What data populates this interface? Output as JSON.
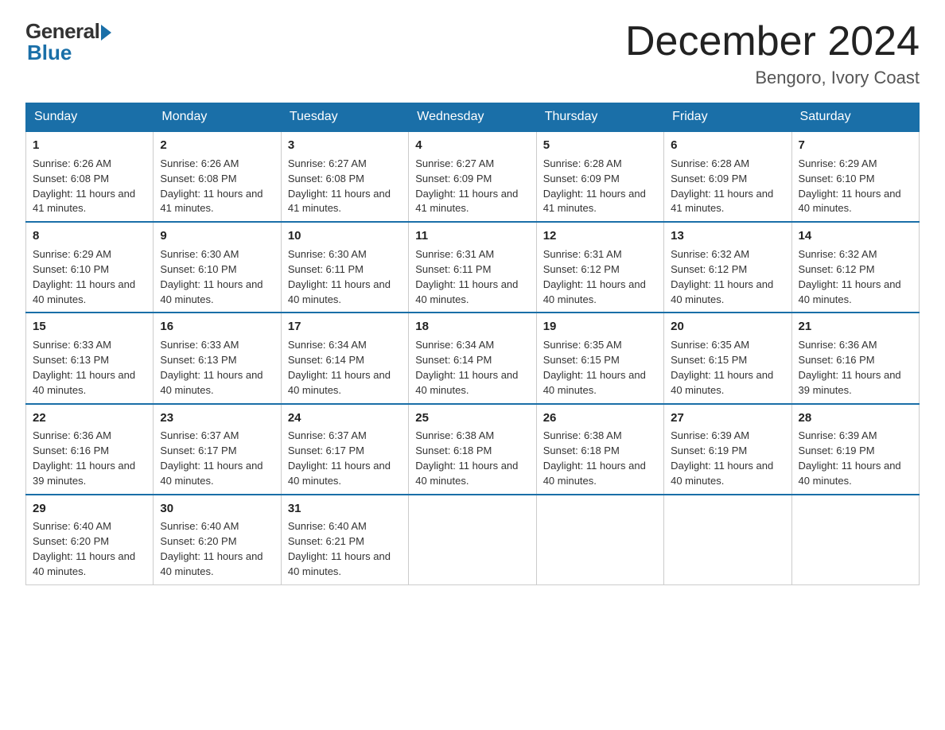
{
  "logo": {
    "general": "General",
    "blue": "Blue"
  },
  "title": "December 2024",
  "location": "Bengoro, Ivory Coast",
  "days_of_week": [
    "Sunday",
    "Monday",
    "Tuesday",
    "Wednesday",
    "Thursday",
    "Friday",
    "Saturday"
  ],
  "weeks": [
    [
      {
        "day": 1,
        "sunrise": "6:26 AM",
        "sunset": "6:08 PM",
        "daylight": "11 hours and 41 minutes."
      },
      {
        "day": 2,
        "sunrise": "6:26 AM",
        "sunset": "6:08 PM",
        "daylight": "11 hours and 41 minutes."
      },
      {
        "day": 3,
        "sunrise": "6:27 AM",
        "sunset": "6:08 PM",
        "daylight": "11 hours and 41 minutes."
      },
      {
        "day": 4,
        "sunrise": "6:27 AM",
        "sunset": "6:09 PM",
        "daylight": "11 hours and 41 minutes."
      },
      {
        "day": 5,
        "sunrise": "6:28 AM",
        "sunset": "6:09 PM",
        "daylight": "11 hours and 41 minutes."
      },
      {
        "day": 6,
        "sunrise": "6:28 AM",
        "sunset": "6:09 PM",
        "daylight": "11 hours and 41 minutes."
      },
      {
        "day": 7,
        "sunrise": "6:29 AM",
        "sunset": "6:10 PM",
        "daylight": "11 hours and 40 minutes."
      }
    ],
    [
      {
        "day": 8,
        "sunrise": "6:29 AM",
        "sunset": "6:10 PM",
        "daylight": "11 hours and 40 minutes."
      },
      {
        "day": 9,
        "sunrise": "6:30 AM",
        "sunset": "6:10 PM",
        "daylight": "11 hours and 40 minutes."
      },
      {
        "day": 10,
        "sunrise": "6:30 AM",
        "sunset": "6:11 PM",
        "daylight": "11 hours and 40 minutes."
      },
      {
        "day": 11,
        "sunrise": "6:31 AM",
        "sunset": "6:11 PM",
        "daylight": "11 hours and 40 minutes."
      },
      {
        "day": 12,
        "sunrise": "6:31 AM",
        "sunset": "6:12 PM",
        "daylight": "11 hours and 40 minutes."
      },
      {
        "day": 13,
        "sunrise": "6:32 AM",
        "sunset": "6:12 PM",
        "daylight": "11 hours and 40 minutes."
      },
      {
        "day": 14,
        "sunrise": "6:32 AM",
        "sunset": "6:12 PM",
        "daylight": "11 hours and 40 minutes."
      }
    ],
    [
      {
        "day": 15,
        "sunrise": "6:33 AM",
        "sunset": "6:13 PM",
        "daylight": "11 hours and 40 minutes."
      },
      {
        "day": 16,
        "sunrise": "6:33 AM",
        "sunset": "6:13 PM",
        "daylight": "11 hours and 40 minutes."
      },
      {
        "day": 17,
        "sunrise": "6:34 AM",
        "sunset": "6:14 PM",
        "daylight": "11 hours and 40 minutes."
      },
      {
        "day": 18,
        "sunrise": "6:34 AM",
        "sunset": "6:14 PM",
        "daylight": "11 hours and 40 minutes."
      },
      {
        "day": 19,
        "sunrise": "6:35 AM",
        "sunset": "6:15 PM",
        "daylight": "11 hours and 40 minutes."
      },
      {
        "day": 20,
        "sunrise": "6:35 AM",
        "sunset": "6:15 PM",
        "daylight": "11 hours and 40 minutes."
      },
      {
        "day": 21,
        "sunrise": "6:36 AM",
        "sunset": "6:16 PM",
        "daylight": "11 hours and 39 minutes."
      }
    ],
    [
      {
        "day": 22,
        "sunrise": "6:36 AM",
        "sunset": "6:16 PM",
        "daylight": "11 hours and 39 minutes."
      },
      {
        "day": 23,
        "sunrise": "6:37 AM",
        "sunset": "6:17 PM",
        "daylight": "11 hours and 40 minutes."
      },
      {
        "day": 24,
        "sunrise": "6:37 AM",
        "sunset": "6:17 PM",
        "daylight": "11 hours and 40 minutes."
      },
      {
        "day": 25,
        "sunrise": "6:38 AM",
        "sunset": "6:18 PM",
        "daylight": "11 hours and 40 minutes."
      },
      {
        "day": 26,
        "sunrise": "6:38 AM",
        "sunset": "6:18 PM",
        "daylight": "11 hours and 40 minutes."
      },
      {
        "day": 27,
        "sunrise": "6:39 AM",
        "sunset": "6:19 PM",
        "daylight": "11 hours and 40 minutes."
      },
      {
        "day": 28,
        "sunrise": "6:39 AM",
        "sunset": "6:19 PM",
        "daylight": "11 hours and 40 minutes."
      }
    ],
    [
      {
        "day": 29,
        "sunrise": "6:40 AM",
        "sunset": "6:20 PM",
        "daylight": "11 hours and 40 minutes."
      },
      {
        "day": 30,
        "sunrise": "6:40 AM",
        "sunset": "6:20 PM",
        "daylight": "11 hours and 40 minutes."
      },
      {
        "day": 31,
        "sunrise": "6:40 AM",
        "sunset": "6:21 PM",
        "daylight": "11 hours and 40 minutes."
      },
      null,
      null,
      null,
      null
    ]
  ]
}
